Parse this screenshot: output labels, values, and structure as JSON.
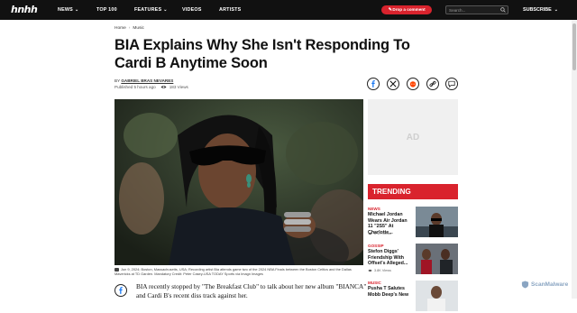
{
  "nav": {
    "logo": "hnhh",
    "items": [
      {
        "label": "NEWS",
        "has_dropdown": true
      },
      {
        "label": "TOP 100",
        "has_dropdown": false
      },
      {
        "label": "FEATURES",
        "has_dropdown": true
      },
      {
        "label": "VIDEOS",
        "has_dropdown": false
      },
      {
        "label": "ARTISTS",
        "has_dropdown": false
      }
    ],
    "drop_comment": "Drop a comment",
    "search_placeholder": "Search...",
    "subscribe": "SUBSCRIBE"
  },
  "breadcrumb": [
    "Home",
    "Music"
  ],
  "article": {
    "headline": "BIA Explains Why She Isn't Responding To Cardi B Anytime Soon",
    "by_prefix": "BY",
    "author": "GABRIEL BRAS NEVARES",
    "published": "Published 5 hours ago",
    "views": "183 Views",
    "share_buttons": [
      "facebook-icon",
      "x-icon",
      "reddit-icon",
      "link-icon",
      "comment-icon"
    ],
    "caption": "Jun 9, 2024; Boston, Massachusetts, USA; Recording artist Bia attends game two of the 2024 NBA Finals between the Boston Celtics and the Dallas Mavericks at TD Garden. Mandatory Credit: Peter Casey-USA TODAY Sports via Imagn Images",
    "body": "BIA recently stopped by \"The Breakfast Club\" to talk about her new album \"BIANCA\" and Cardi B's recent diss track against her."
  },
  "sidebar": {
    "ad_label": "AD",
    "trending_title": "TRENDING",
    "trending": [
      {
        "category": "NEWS",
        "title": "Michael Jordan Wears Air Jordan 11 \"2S5\" At Charlotte...",
        "views": "6.1K Views"
      },
      {
        "category": "GOSSIP",
        "title": "Stefon Diggs' Friendship With Offset's Alleged...",
        "views": "3.8K Views"
      },
      {
        "category": "MUSIC",
        "title": "Pusha T Salutes Mobb Deep's New",
        "views": ""
      }
    ]
  },
  "watermark": "ScanMalware",
  "colors": {
    "accent": "#d9232d",
    "nav_bg": "#111111"
  }
}
